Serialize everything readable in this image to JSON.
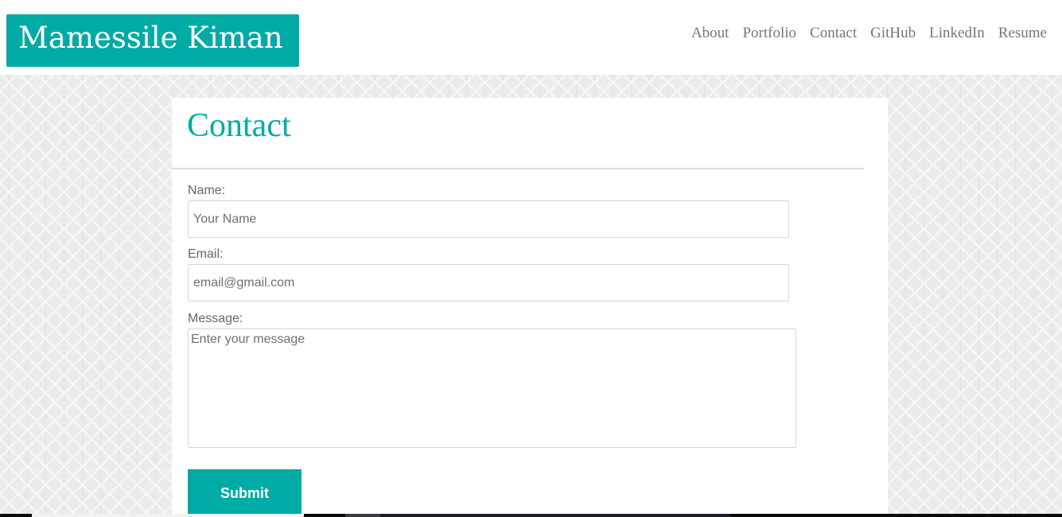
{
  "header": {
    "brand": "Mamessile Kiman",
    "nav": [
      "About",
      "Portfolio",
      "Contact",
      "GitHub",
      "LinkedIn",
      "Resume"
    ]
  },
  "contact": {
    "title": "Contact",
    "name_label": "Name:",
    "name_placeholder": "Your Name",
    "email_label": "Email:",
    "email_placeholder": "email@gmail.com",
    "message_label": "Message:",
    "message_placeholder": "Enter your message",
    "submit_label": "Submit"
  },
  "colors": {
    "accent": "#00aba5",
    "nav_text": "#767676",
    "label_text": "#666666",
    "background_pattern": "#ebebeb"
  }
}
